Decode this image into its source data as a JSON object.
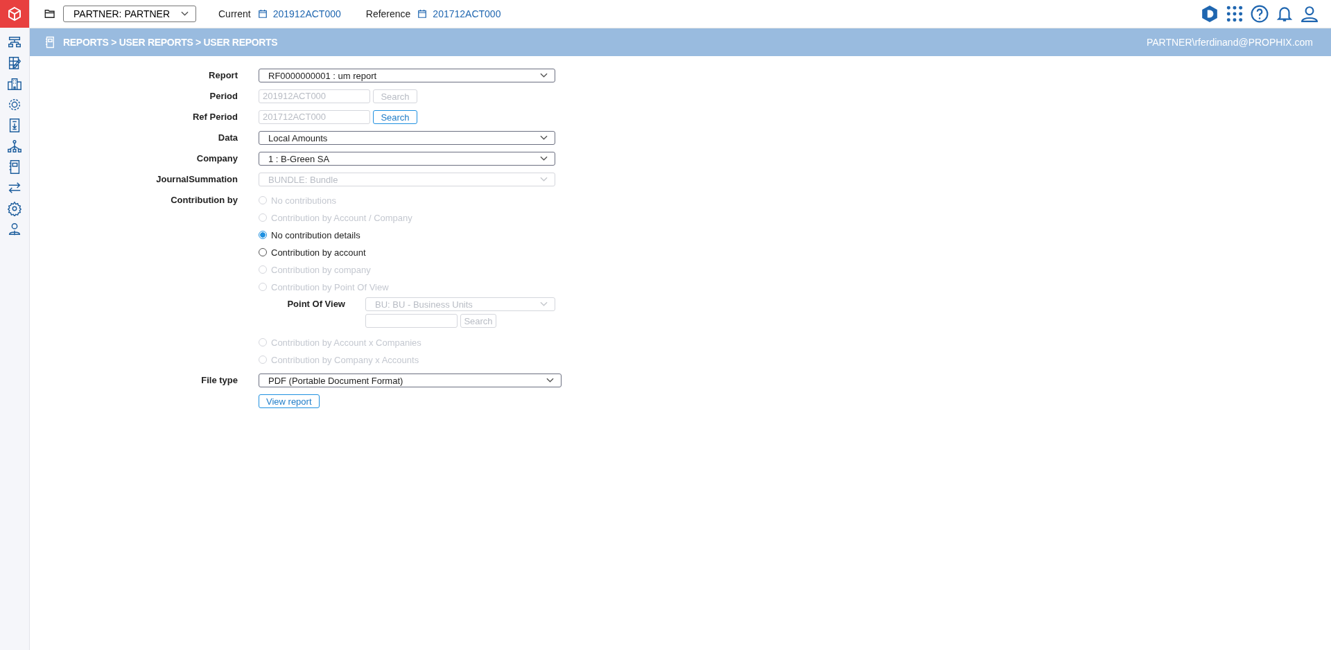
{
  "topbar": {
    "partner_select": "PARTNER: PARTNER",
    "current_label": "Current",
    "current_value": "201912ACT000",
    "reference_label": "Reference",
    "reference_value": "201712ACT000"
  },
  "header": {
    "breadcrumb": "REPORTS > USER REPORTS > USER REPORTS",
    "user": "PARTNER\\rferdinand@PROPHIX.com"
  },
  "form": {
    "fields": [
      {
        "kind": "select",
        "label": "Report",
        "value": "RF0000000001 : um report",
        "disabled": false
      },
      {
        "kind": "search",
        "label": "Period",
        "value": "201912ACT000",
        "button": "Search",
        "button_disabled": true
      },
      {
        "kind": "search",
        "label": "Ref Period",
        "value": "201712ACT000",
        "button": "Search",
        "button_disabled": false
      },
      {
        "kind": "select",
        "label": "Data",
        "value": "Local Amounts",
        "disabled": false
      },
      {
        "kind": "select",
        "label": "Company",
        "value": "1 : B-Green SA",
        "disabled": false
      },
      {
        "kind": "select",
        "label": "JournalSummation",
        "value": "BUNDLE: Bundle",
        "disabled": true
      }
    ],
    "contribution": {
      "label": "Contribution by",
      "options": [
        {
          "kind": "radio",
          "label": "No contributions",
          "selected": false,
          "disabled": true
        },
        {
          "kind": "radio",
          "label": "Contribution by Account / Company",
          "selected": false,
          "disabled": true
        },
        {
          "kind": "radio",
          "label": "No contribution details",
          "selected": true,
          "disabled": false
        },
        {
          "kind": "radio",
          "label": "Contribution by account",
          "selected": false,
          "disabled": false
        },
        {
          "kind": "radio",
          "label": "Contribution by company",
          "selected": false,
          "disabled": true
        },
        {
          "kind": "radio",
          "label": "Contribution by Point Of View",
          "selected": false,
          "disabled": true
        },
        {
          "kind": "subfield",
          "label": "Point Of View",
          "value": "BU: BU - Business Units",
          "button": "Search",
          "disabled": true
        },
        {
          "kind": "radio",
          "label": "Contribution by Account x Companies",
          "selected": false,
          "disabled": true
        },
        {
          "kind": "radio",
          "label": "Contribution by Company x Accounts",
          "selected": false,
          "disabled": true
        }
      ]
    },
    "file_type": {
      "label": "File type",
      "value": "PDF (Portable Document Format)"
    },
    "submit": "View report"
  }
}
